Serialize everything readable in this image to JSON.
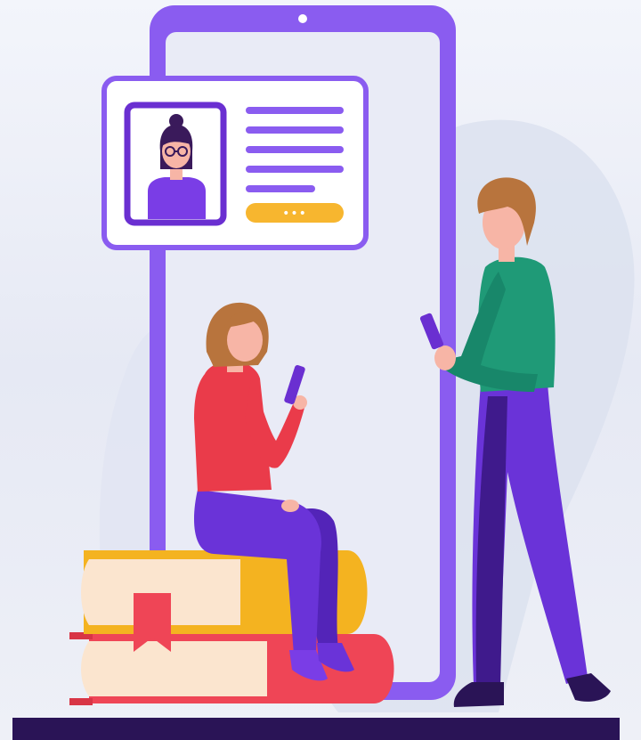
{
  "illustration": {
    "profile_card": {
      "button_label": "•••"
    },
    "colors": {
      "phone_frame": "#8a5cf0",
      "phone_screen": "#e9ebf6",
      "accent_purple": "#7b3fe4",
      "card_button": "#f7b62f",
      "woman_shirt": "#ea3b4a",
      "woman_hair": "#b8743d",
      "man_shirt": "#1f9a77",
      "man_pants": "#6a33d8",
      "book_yellow": "#f4b320",
      "book_red": "#ef4556",
      "book_pages": "#fbe5cf",
      "floor": "#2a1456"
    }
  }
}
